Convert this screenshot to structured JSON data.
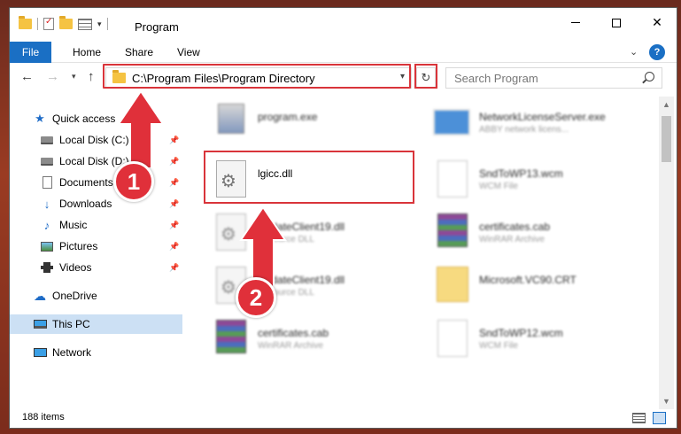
{
  "window": {
    "title": "Program",
    "ribbon": {
      "file": "File",
      "home": "Home",
      "share": "Share",
      "view": "View",
      "help": "?"
    }
  },
  "nav": {
    "address": "C:\\Program Files\\Program Directory",
    "search_placeholder": "Search Program"
  },
  "sidebar": {
    "items": [
      {
        "label": "Quick access",
        "icon": "star-icon",
        "pinned": false
      },
      {
        "label": "Local Disk (C:)",
        "icon": "disk-icon",
        "pinned": true
      },
      {
        "label": "Local Disk (D:)",
        "icon": "disk-icon",
        "pinned": true
      },
      {
        "label": "Documents",
        "icon": "document-icon",
        "pinned": true
      },
      {
        "label": "Downloads",
        "icon": "download-icon",
        "pinned": true
      },
      {
        "label": "Music",
        "icon": "music-icon",
        "pinned": true
      },
      {
        "label": "Pictures",
        "icon": "picture-icon",
        "pinned": true
      },
      {
        "label": "Videos",
        "icon": "video-icon",
        "pinned": true
      },
      {
        "label": "OneDrive",
        "icon": "cloud-icon",
        "pinned": false
      },
      {
        "label": "This PC",
        "icon": "computer-icon",
        "pinned": false,
        "selected": true
      },
      {
        "label": "Network",
        "icon": "network-icon",
        "pinned": false
      }
    ]
  },
  "files": [
    {
      "name": "program.exe",
      "type": "",
      "icon": "exe-icon",
      "blurred": true
    },
    {
      "name": "NetworkLicenseServer.exe",
      "type": "ABBY network licens...",
      "icon": "server-icon",
      "blurred": true
    },
    {
      "name": "lgicc.dll",
      "type": "",
      "icon": "dll-icon",
      "blurred": false
    },
    {
      "name": "SndToWP13.wcm",
      "type": "WCM File",
      "icon": "document-icon",
      "blurred": true
    },
    {
      "name": "UpdateClient19.dll",
      "type": "Resource DLL",
      "icon": "dll-icon",
      "blurred": true
    },
    {
      "name": "certificates.cab",
      "type": "WinRAR Archive",
      "icon": "archive-icon",
      "blurred": true
    },
    {
      "name": "UpdateClient19.dll",
      "type": "Resource DLL",
      "icon": "dll-icon",
      "blurred": true
    },
    {
      "name": "Microsoft.VC90.CRT",
      "type": "",
      "icon": "folder-icon",
      "blurred": true
    },
    {
      "name": "certificates.cab",
      "type": "WinRAR Archive",
      "icon": "archive-icon",
      "blurred": true
    },
    {
      "name": "SndToWP12.wcm",
      "type": "WCM File",
      "icon": "document-icon",
      "blurred": true
    }
  ],
  "status": {
    "count": "188 items"
  },
  "annotations": {
    "step1": "1",
    "step2": "2",
    "color": "#d9343a"
  },
  "colors": {
    "accent": "#1a6fc4",
    "selection": "#cce0f4"
  }
}
